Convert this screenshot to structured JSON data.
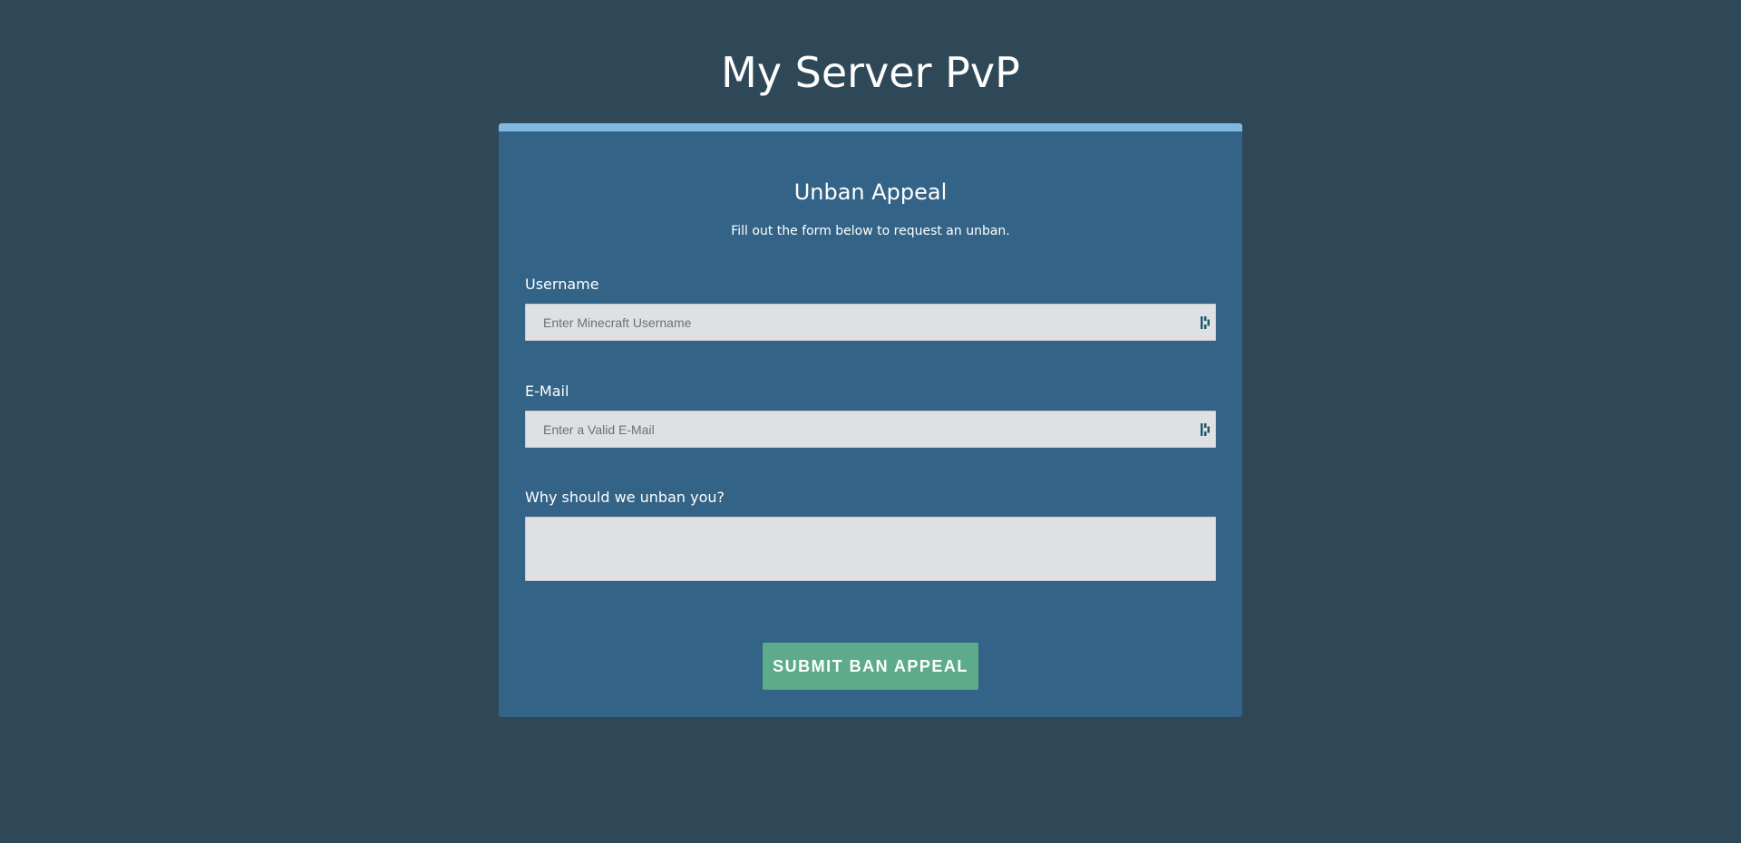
{
  "header": {
    "title": "My Server PvP"
  },
  "form": {
    "heading": "Unban Appeal",
    "subtitle": "Fill out the form below to request an unban.",
    "username": {
      "label": "Username",
      "placeholder": "Enter Minecraft Username",
      "value": ""
    },
    "email": {
      "label": "E-Mail",
      "placeholder": "Enter a Valid E-Mail",
      "value": ""
    },
    "reason": {
      "label": "Why should we unban you?",
      "value": ""
    },
    "submit_label": "SUBMIT BAN APPEAL"
  },
  "icons": {
    "field_autofill": "password-manager-icon"
  },
  "colors": {
    "background": "#2f4858",
    "card": "#336386",
    "accent": "#7fb8e0",
    "submit": "#5dab8b",
    "input": "#dfe0e4"
  }
}
